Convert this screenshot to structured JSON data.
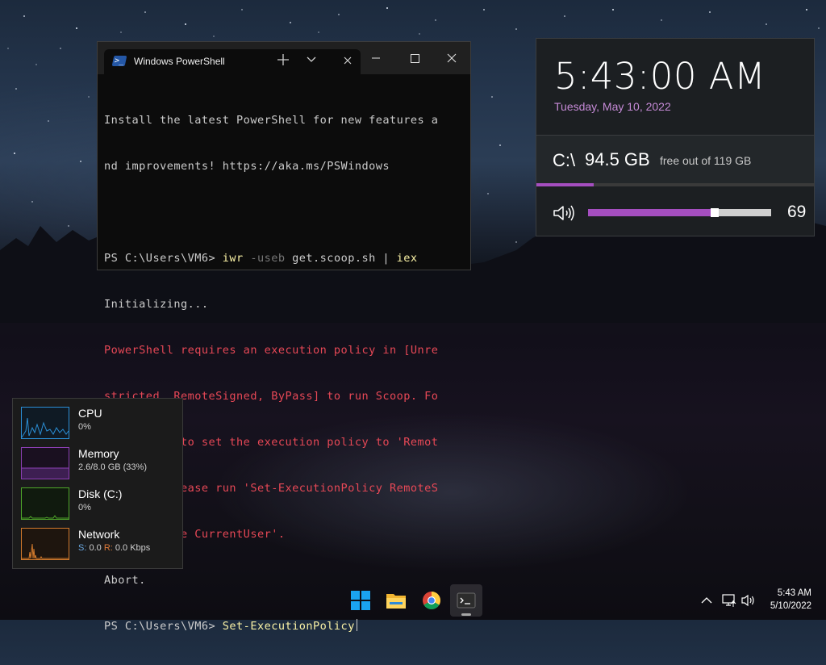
{
  "terminal": {
    "tab_title": "Windows PowerShell",
    "lines": {
      "l1": "Install the latest PowerShell for new features a",
      "l2": "nd improvements! https://aka.ms/PSWindows",
      "prompt1": "PS C:\\Users\\VM6> ",
      "cmd_iwr": "iwr",
      "param_useb": " -useb",
      "arg_url": " get.scoop.sh | ",
      "cmd_iex": "iex",
      "l4": "Initializing...",
      "err1": "PowerShell requires an execution policy in [Unre",
      "err2": "stricted, RemoteSigned, ByPass] to run Scoop. Fo",
      "err3": "r example, to set the execution policy to 'Remot",
      "err4": "eSigned' please run 'Set-ExecutionPolicy RemoteS",
      "err5": "igned -Scope CurrentUser'.",
      "abort": "Abort.",
      "prompt2": "PS C:\\Users\\VM6> ",
      "cmd_current": "Set-ExecutionPolicy"
    },
    "icons": {
      "powershell": "powershell-icon",
      "close_tab": "close-icon",
      "new_tab": "plus-icon",
      "dropdown": "chevron-down-icon"
    }
  },
  "widget": {
    "time": "5:43:00 AM",
    "date": "Tuesday, May 10, 2022",
    "drive_letter": "C:\\",
    "drive_free": "94.5 GB",
    "drive_total": "free out of 119 GB",
    "drive_used_fraction": 0.206,
    "volume_value": "69",
    "volume_fraction": 0.69,
    "accent_color": "#a54ec0"
  },
  "perf": {
    "cpu": {
      "name": "CPU",
      "value": "0%",
      "color": "#2b8fd6"
    },
    "memory": {
      "name": "Memory",
      "value": "2.6/8.0 GB (33%)",
      "color": "#8b3fb3"
    },
    "disk": {
      "name": "Disk (C:)",
      "value": "0%",
      "color": "#4fa82a"
    },
    "network": {
      "name": "Network",
      "s_label": "S:",
      "s_value": " 0.0 ",
      "r_label": "R:",
      "r_value": " 0.0 Kbps",
      "color": "#d27a2c"
    }
  },
  "taskbar": {
    "apps": [
      "start-icon",
      "file-explorer-icon",
      "chrome-icon",
      "terminal-icon"
    ],
    "tray_time": "5:43 AM",
    "tray_date": "5/10/2022"
  }
}
